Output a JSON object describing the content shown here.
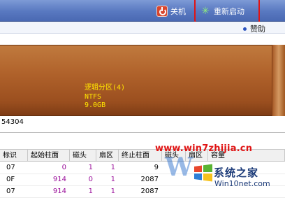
{
  "toolbar": {
    "shutdown_label": "关机",
    "restart_label": "重新启动"
  },
  "menubar": {
    "help_label": "赞助"
  },
  "disk": {
    "partition": {
      "name": "逻辑分区(4)",
      "filesystem": "NTFS",
      "size": "9.0GB"
    },
    "info_text": "54304"
  },
  "table": {
    "headers": [
      "标识",
      "起始柱面",
      "磁头",
      "扇区",
      "终止柱面",
      "磁头",
      "扇区",
      "容量"
    ],
    "rows": [
      [
        "07",
        "0",
        "1",
        "1",
        "9",
        "",
        "",
        ""
      ],
      [
        "0F",
        "914",
        "0",
        "1",
        "2087",
        "",
        "",
        ""
      ],
      [
        "07",
        "914",
        "1",
        "1",
        "2087",
        "",
        "",
        ""
      ]
    ]
  },
  "watermark": {
    "url": "www.win7zhijia.cn",
    "title": "系统之家",
    "site": "Win10net.com",
    "logo_letter": "W"
  },
  "colors": {
    "toolbar": "#5878c0",
    "disk_bar": "#b0622b",
    "partition_text": "#ffe400",
    "highlight": "#e01414",
    "cell_purple": "#9a0f9a"
  }
}
